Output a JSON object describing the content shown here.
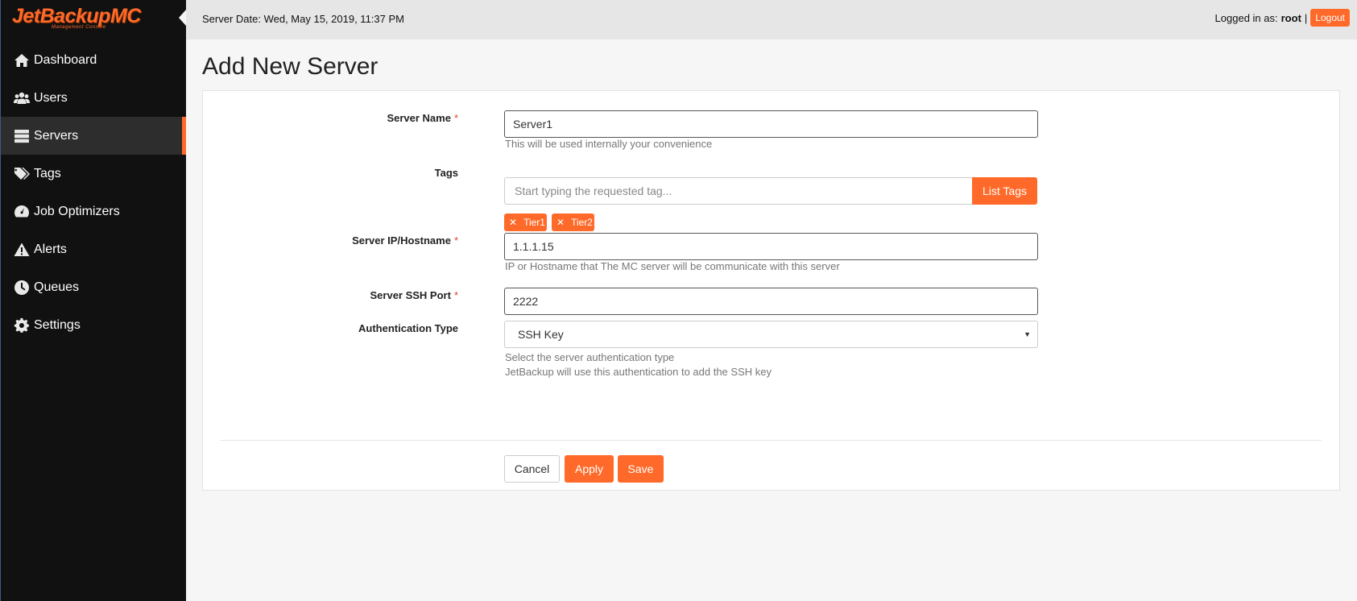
{
  "brand": {
    "logo_text": "JetBackupMC",
    "logo_subtitle": "Management Console",
    "accent": "#ff6a2a"
  },
  "sidebar": {
    "items": [
      {
        "label": "Dashboard",
        "icon": "home-icon"
      },
      {
        "label": "Users",
        "icon": "users-icon"
      },
      {
        "label": "Servers",
        "icon": "server-icon",
        "active": true
      },
      {
        "label": "Tags",
        "icon": "tags-icon"
      },
      {
        "label": "Job Optimizers",
        "icon": "gauge-icon"
      },
      {
        "label": "Alerts",
        "icon": "warning-icon"
      },
      {
        "label": "Queues",
        "icon": "clock-icon"
      },
      {
        "label": "Settings",
        "icon": "gear-icon"
      }
    ]
  },
  "topbar": {
    "server_date": "Server Date: Wed, May 15, 2019, 11:37 PM",
    "logged_in_label": "Logged in as:",
    "username": "root",
    "separator": "|",
    "logout_label": "Logout"
  },
  "page": {
    "title": "Add New Server"
  },
  "form": {
    "server_name": {
      "label": "Server Name",
      "required": "*",
      "value": "Server1",
      "help": "This will be used internally your convenience"
    },
    "tags": {
      "label": "Tags",
      "placeholder": "Start typing the requested tag...",
      "list_button": "List Tags",
      "chips": [
        {
          "remove": "✕",
          "label": "Tier1"
        },
        {
          "remove": "✕",
          "label": "Tier2"
        }
      ]
    },
    "hostname": {
      "label": "Server IP/Hostname",
      "required": "*",
      "value": "1.1.1.15",
      "help": "IP or Hostname that The MC server will be communicate with this server"
    },
    "ssh_port": {
      "label": "Server SSH Port",
      "required": "*",
      "value": "2222"
    },
    "auth_type": {
      "label": "Authentication Type",
      "selected": "SSH Key",
      "arrow": "▼",
      "help_1": "Select the server authentication type",
      "help_2": "JetBackup will use this authentication to add the SSH key"
    },
    "buttons": {
      "cancel": "Cancel",
      "apply": "Apply",
      "save": "Save"
    }
  }
}
